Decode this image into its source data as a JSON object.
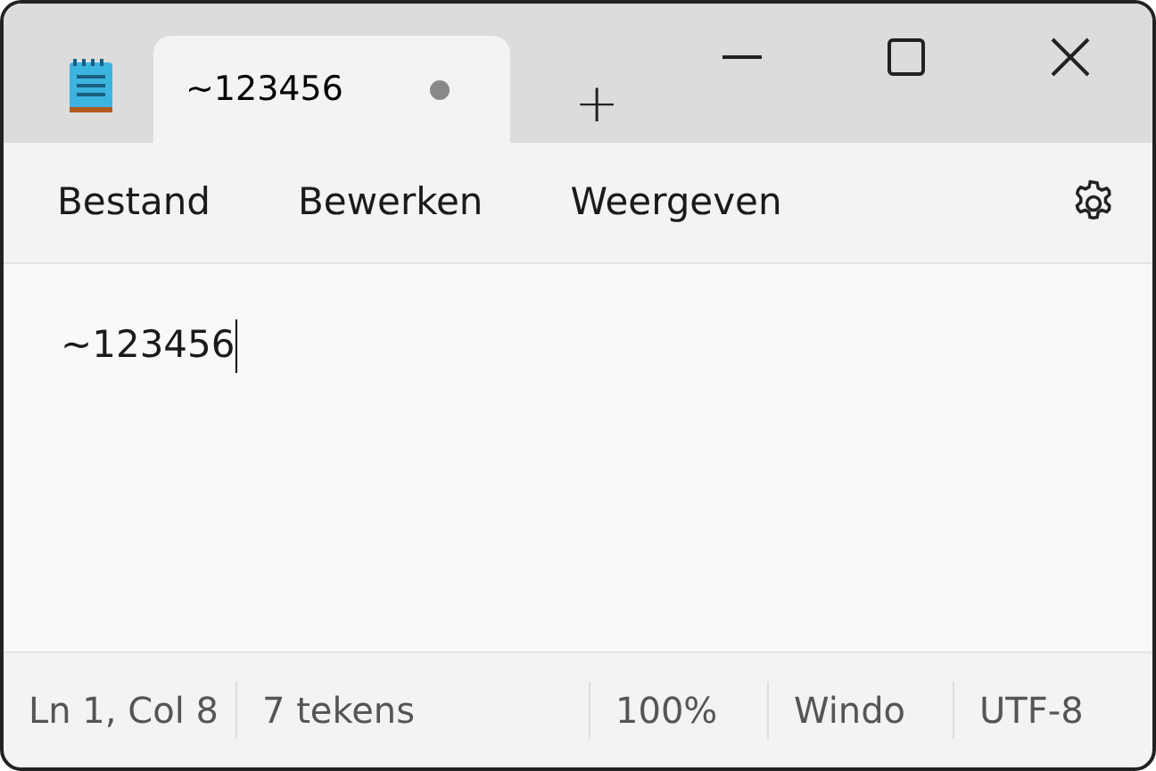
{
  "tabs": [
    {
      "title": "~123456",
      "modified": true,
      "selected": true
    }
  ],
  "new_tab_button": "+",
  "menu": [
    "Bestand",
    "Bewerken",
    "Weergeven"
  ],
  "editor": {
    "text": "~123456",
    "caret": true
  },
  "status_bar": [
    {
      "text": "Ln 1, Col 8"
    },
    {
      "text": "7 tekens"
    },
    {
      "text": "100%"
    },
    {
      "text": "Windo"
    },
    {
      "text": "UTF-8"
    }
  ]
}
